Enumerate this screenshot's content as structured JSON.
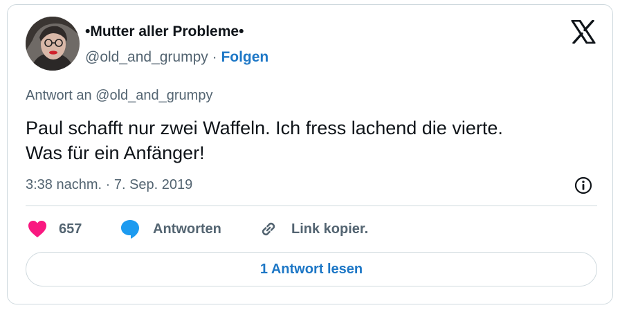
{
  "author": {
    "display_name": "•Mutter aller Probleme•",
    "handle": "@old_and_grumpy",
    "separator": " · ",
    "follow_label": "Folgen"
  },
  "tweet": {
    "reply_to": "Antwort an @old_and_grumpy",
    "text_line1": "Paul schafft nur zwei Waffeln. Ich fress lachend die vierte.",
    "text_line2": "Was für ein Anfänger!",
    "timestamp": "3:38 nachm. · 7. Sep. 2019"
  },
  "actions": {
    "like_count": "657",
    "reply_label": "Antworten",
    "copy_link_label": "Link kopier."
  },
  "footer": {
    "read_replies_label": "1 Antwort lesen"
  },
  "colors": {
    "heart": "#f91880",
    "reply_bubble": "#1d9bf0",
    "link_blue": "#1d77c6",
    "secondary_text": "#536471"
  },
  "icons": [
    "x-logo-icon",
    "info-icon",
    "heart-icon",
    "reply-bubble-icon",
    "link-icon"
  ]
}
